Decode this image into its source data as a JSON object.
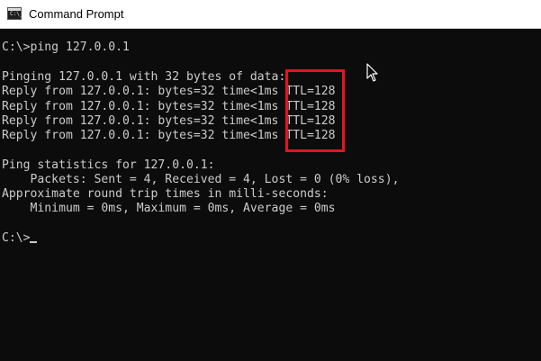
{
  "window": {
    "title": "Command Prompt",
    "icon_text": "C:\\_"
  },
  "console": {
    "lines": [
      "C:\\>ping 127.0.0.1",
      "",
      "Pinging 127.0.0.1 with 32 bytes of data:",
      "Reply from 127.0.0.1: bytes=32 time<1ms TTL=128",
      "Reply from 127.0.0.1: bytes=32 time<1ms TTL=128",
      "Reply from 127.0.0.1: bytes=32 time<1ms TTL=128",
      "Reply from 127.0.0.1: bytes=32 time<1ms TTL=128",
      "",
      "Ping statistics for 127.0.0.1:",
      "    Packets: Sent = 4, Received = 4, Lost = 0 (0% loss),",
      "Approximate round trip times in milli-seconds:",
      "    Minimum = 0ms, Maximum = 0ms, Average = 0ms",
      "",
      "C:\\>"
    ]
  },
  "colors": {
    "console_background": "#0c0c0c",
    "console_text": "#cccccc",
    "highlight_border": "#e81123"
  }
}
